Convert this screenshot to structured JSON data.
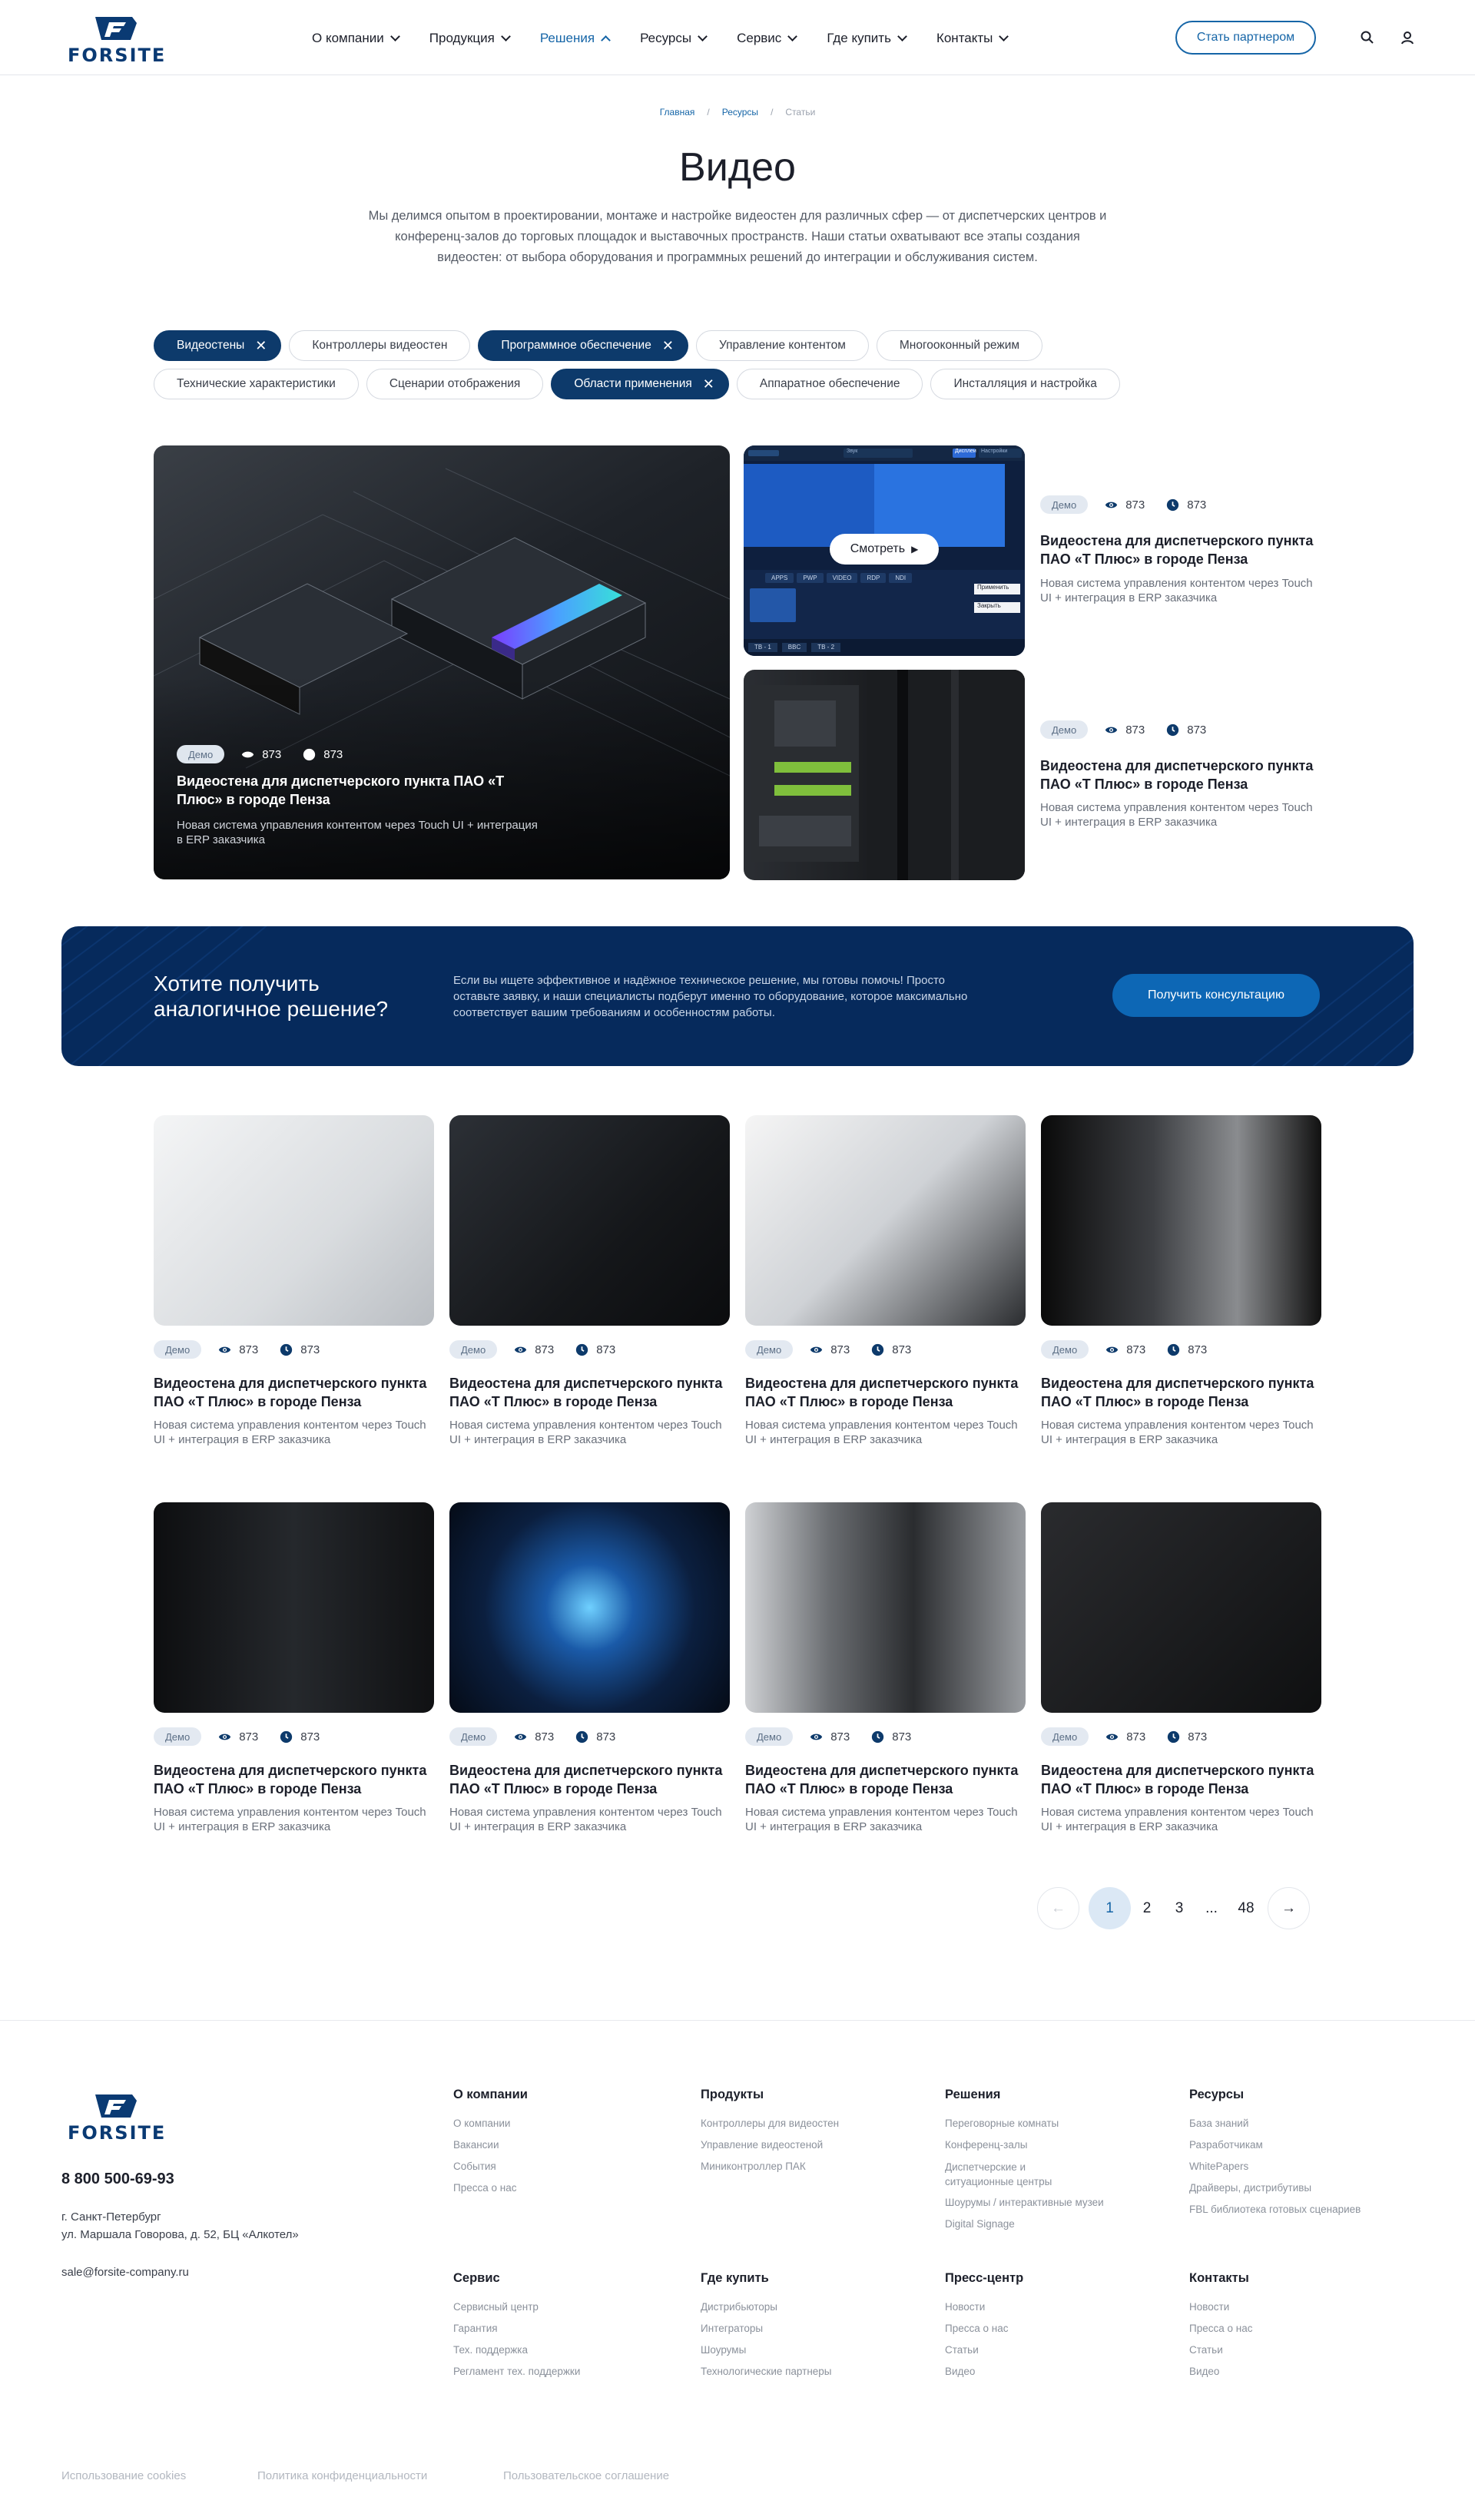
{
  "header": {
    "logo_text": "FORSITE",
    "nav": [
      {
        "label": "О компании",
        "active": false
      },
      {
        "label": "Продукция",
        "active": false
      },
      {
        "label": "Решения",
        "active": true
      },
      {
        "label": "Ресурсы",
        "active": false
      },
      {
        "label": "Сервис",
        "active": false
      },
      {
        "label": "Где купить",
        "active": false
      },
      {
        "label": "Контакты",
        "active": false
      }
    ],
    "partner_button": "Стать партнером",
    "icons": [
      "search-icon",
      "user-icon"
    ]
  },
  "breadcrumbs": [
    "Главная",
    "Ресурсы",
    "Статьи"
  ],
  "page": {
    "title": "Видео",
    "lead": "Мы делимся опытом в проектировании, монтаже и настройке видеостен для различных сфер — от диспетчерских центров и конференц-залов до торговых площадок и выставочных пространств. Наши статьи охватывают все этапы создания видеостен: от выбора оборудования и программных решений до интеграции и обслуживания систем."
  },
  "filters": {
    "row1": [
      {
        "label": "Видеостены",
        "selected": true
      },
      {
        "label": "Контроллеры видеостен",
        "selected": false
      },
      {
        "label": "Программное обеспечение",
        "selected": true
      },
      {
        "label": "Управление контентом",
        "selected": false
      },
      {
        "label": "Многооконный режим",
        "selected": false
      }
    ],
    "row2": [
      {
        "label": "Технические характеристики",
        "selected": false
      },
      {
        "label": "Сценарии отображения",
        "selected": false
      },
      {
        "label": "Области применения",
        "selected": true
      },
      {
        "label": "Аппаратное обеспечение",
        "selected": false
      },
      {
        "label": "Инсталляция и настройка",
        "selected": false
      }
    ]
  },
  "featured": {
    "main": {
      "badge": "Демо",
      "views": "873",
      "time": "873",
      "title": "Видеостена для диспетчерского пункта ПАО «Т Плюс» в городе Пенза",
      "desc": "Новая система управления контентом через Touch UI + интеграция в ERP заказчика"
    },
    "side": [
      {
        "badge": "Демо",
        "views": "873",
        "time": "873",
        "title": "Видеостена для диспетчерского пункта ПАО «Т Плюс» в городе Пенза",
        "desc": "Новая система управления контентом через Touch UI + интеграция в ERP заказчика",
        "play_label": "Смотреть",
        "ui": {
          "tabs": [
            "Звук",
            "Дисплеи",
            "Настройки"
          ],
          "apps": [
            "APPS",
            "PWP",
            "VIDEO",
            "RDP",
            "NDI"
          ],
          "btns": [
            "Применить",
            "Закрыть"
          ],
          "foot": [
            "TB - 1",
            "BBC",
            "TB - 2"
          ]
        }
      },
      {
        "badge": "Демо",
        "views": "873",
        "time": "873",
        "title": "Видеостена для диспетчерского пункта ПАО «Т Плюс» в городе Пенза",
        "desc": "Новая система управления контентом через Touch UI + интеграция в ERP заказчика"
      }
    ]
  },
  "cta": {
    "title": "Хотите получить аналогичное решение?",
    "text": "Если вы ищете эффективное и надёжное техническое решение, мы готовы помочь! Просто оставьте заявку, и наши специалисты подберут именно то оборудование, которое максимально соответствует вашим требованиям и особенностям работы.",
    "button": "Получить консультацию"
  },
  "grid": [
    {
      "badge": "Демо",
      "views": "873",
      "time": "873",
      "title": "Видеостена для диспетчерского пункта ПАО «Т Плюс» в городе Пенза",
      "desc": "Новая система управления контентом через Touch UI + интеграция в ERP заказчика"
    },
    {
      "badge": "Демо",
      "views": "873",
      "time": "873",
      "title": "Видеостена для диспетчерского пункта ПАО «Т Плюс» в городе Пенза",
      "desc": "Новая система управления контентом через Touch UI + интеграция в ERP заказчика"
    },
    {
      "badge": "Демо",
      "views": "873",
      "time": "873",
      "title": "Видеостена для диспетчерского пункта ПАО «Т Плюс» в городе Пенза",
      "desc": "Новая система управления контентом через Touch UI + интеграция в ERP заказчика"
    },
    {
      "badge": "Демо",
      "views": "873",
      "time": "873",
      "title": "Видеостена для диспетчерского пункта ПАО «Т Плюс» в городе Пенза",
      "desc": "Новая система управления контентом через Touch UI + интеграция в ERP заказчика"
    },
    {
      "badge": "Демо",
      "views": "873",
      "time": "873",
      "title": "Видеостена для диспетчерского пункта ПАО «Т Плюс» в городе Пенза",
      "desc": "Новая система управления контентом через Touch UI + интеграция в ERP заказчика"
    },
    {
      "badge": "Демо",
      "views": "873",
      "time": "873",
      "title": "Видеостена для диспетчерского пункта ПАО «Т Плюс» в городе Пенза",
      "desc": "Новая система управления контентом через Touch UI + интеграция в ERP заказчика"
    },
    {
      "badge": "Демо",
      "views": "873",
      "time": "873",
      "title": "Видеостена для диспетчерского пункта ПАО «Т Плюс» в городе Пенза",
      "desc": "Новая система управления контентом через Touch UI + интеграция в ERP заказчика"
    },
    {
      "badge": "Демо",
      "views": "873",
      "time": "873",
      "title": "Видеостена для диспетчерского пункта ПАО «Т Плюс» в городе Пенза",
      "desc": "Новая система управления контентом через Touch UI + интеграция в ERP заказчика"
    }
  ],
  "pagination": {
    "pages": [
      "1",
      "2",
      "3",
      "...",
      "48"
    ],
    "current": "1"
  },
  "footer": {
    "phone": "8 800 500-69-93",
    "city": "г. Санкт-Петербург",
    "address": "ул. Маршала Говорова, д. 52, БЦ «Алкотел»",
    "email": "sale@forsite-company.ru",
    "columns_top": [
      {
        "title": "О компании",
        "links": [
          "О компании",
          "Вакансии",
          "События",
          "Пресса о нас"
        ]
      },
      {
        "title": "Продукты",
        "links": [
          "Контроллеры для видеостен",
          "Управление видеостеной",
          "Миниконтроллер ПАК"
        ]
      },
      {
        "title": "Решения",
        "links": [
          "Переговорные комнаты",
          "Конференц-залы",
          "Диспетчерские и ситуационные центры",
          "Шоурумы / интерактивные музеи",
          "Digital Signage"
        ]
      },
      {
        "title": "Ресурсы",
        "links": [
          "База знаний",
          "Разработчикам",
          "WhitePapers",
          "Драйверы, дистрибутивы",
          "FBL библиотека готовых сценариев"
        ]
      }
    ],
    "columns_bottom": [
      {
        "title": "Сервис",
        "links": [
          "Сервисный центр",
          "Гарантия",
          "Тех. поддержка",
          "Регламент тех. поддержки"
        ]
      },
      {
        "title": "Где купить",
        "links": [
          "Дистрибьюторы",
          "Интеграторы",
          "Шоурумы",
          "Технологические партнеры"
        ]
      },
      {
        "title": "Пресс-центр",
        "links": [
          "Новости",
          "Пресса о нас",
          "Статьи",
          "Видео"
        ]
      },
      {
        "title": "Контакты",
        "links": [
          "Новости",
          "Пресса о нас",
          "Статьи",
          "Видео"
        ]
      }
    ],
    "legal": [
      "Использование cookies",
      "Политика конфиденциальности",
      "Пользовательское соглашение"
    ]
  },
  "colors": {
    "brand": "#0a3a73",
    "accent": "#1565a7",
    "chip_selected": "#0d3a6b",
    "cta_bg": "#062a5c",
    "cta_button": "#0d67b5"
  }
}
